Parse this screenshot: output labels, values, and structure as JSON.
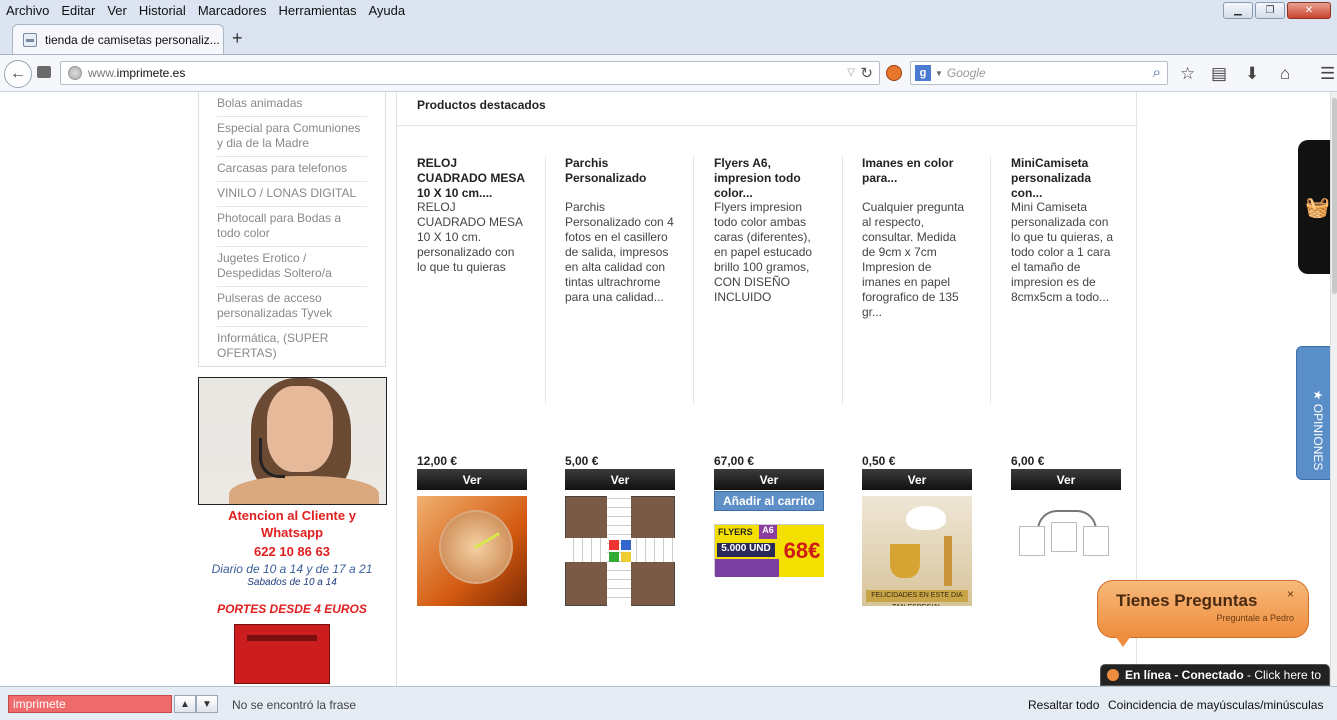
{
  "menu": [
    "Archivo",
    "Editar",
    "Ver",
    "Historial",
    "Marcadores",
    "Herramientas",
    "Ayuda"
  ],
  "tab": {
    "title": "tienda de camisetas personaliz...",
    "new_tab": "+"
  },
  "url": {
    "prefix": "www.",
    "domain": "imprimete.es"
  },
  "search": {
    "engine_letter": "g",
    "placeholder": "Google"
  },
  "sidebar": {
    "categories": [
      "Bolas animadas",
      "Especial para Comuniones y dia de la Madre",
      "Carcasas para telefonos",
      "VINILO / LONAS DIGITAL",
      "Photocall para Bodas a todo color",
      "Jugetes Erotico / Despedidas Soltero/a",
      "Pulseras de acceso personalizadas Tyvek",
      "Informática, (SUPER OFERTAS)"
    ],
    "contact": {
      "title": "Atencion al Cliente y Whatsapp",
      "phone": "622 10 86 63",
      "hours": "Diario de 10 a 14 y de 17 a 21",
      "saturday": "Sabados de 10 a 14"
    },
    "shipping": "PORTES DESDE 4 EUROS"
  },
  "main": {
    "section_title": "Productos destacados",
    "products": [
      {
        "name": "RELOJ CUADRADO MESA 10 X 10 cm....",
        "desc": "RELOJ CUADRADO MESA 10 X 10 cm. personalizado con lo que tu quieras",
        "price": "12,00 €",
        "ver": "Ver"
      },
      {
        "name": "Parchis Personalizado",
        "desc": "Parchis Personalizado con 4 fotos en el casillero de salida, impresos en alta calidad con tintas ultrachrome para una calidad...",
        "price": "5,00 €",
        "ver": "Ver"
      },
      {
        "name": "Flyers A6, impresion todo color...",
        "desc": "Flyers impresion todo color ambas caras (diferentes), en papel estucado brillo 100 gramos, CON DISEÑO INCLUIDO",
        "price": "67,00 €",
        "ver": "Ver",
        "cart": "Añadir al carrito"
      },
      {
        "name": "Imanes en color para...",
        "desc": "Cualquier pregunta al respecto, consultar. Medida de 9cm x 7cm Impresion de imanes en papel forografico de 135 gr...",
        "price": "0,50 €",
        "ver": "Ver"
      },
      {
        "name": "MiniCamiseta personalizada con...",
        "desc": "Mini Camiseta personalizada con lo que tu quieras, a todo color a 1 cara el tamaño de impresion es de 8cmx5cm a todo...",
        "price": "6,00 €",
        "ver": "Ver"
      }
    ],
    "flyer_image": {
      "line1": "FLYERS",
      "size": "A6",
      "qty": "5.000 UND",
      "price": "68€"
    },
    "iman_image": {
      "banner": "FELICIDADES EN ESTE DIA TAN ESPECIAL"
    }
  },
  "opiniones": "★ OPINIONES",
  "chat": {
    "title": "Tienes Preguntas",
    "subtitle": "Preguntale a Pedro",
    "close": "×",
    "status_bold": "En línea - Conectado",
    "status_rest": " - Click here to"
  },
  "findbar": {
    "query": "imprimete",
    "message": "No se encontró la frase",
    "highlight_all": "Resaltar todo",
    "match_case": "Coincidencia de mayúsculas/minúsculas"
  }
}
